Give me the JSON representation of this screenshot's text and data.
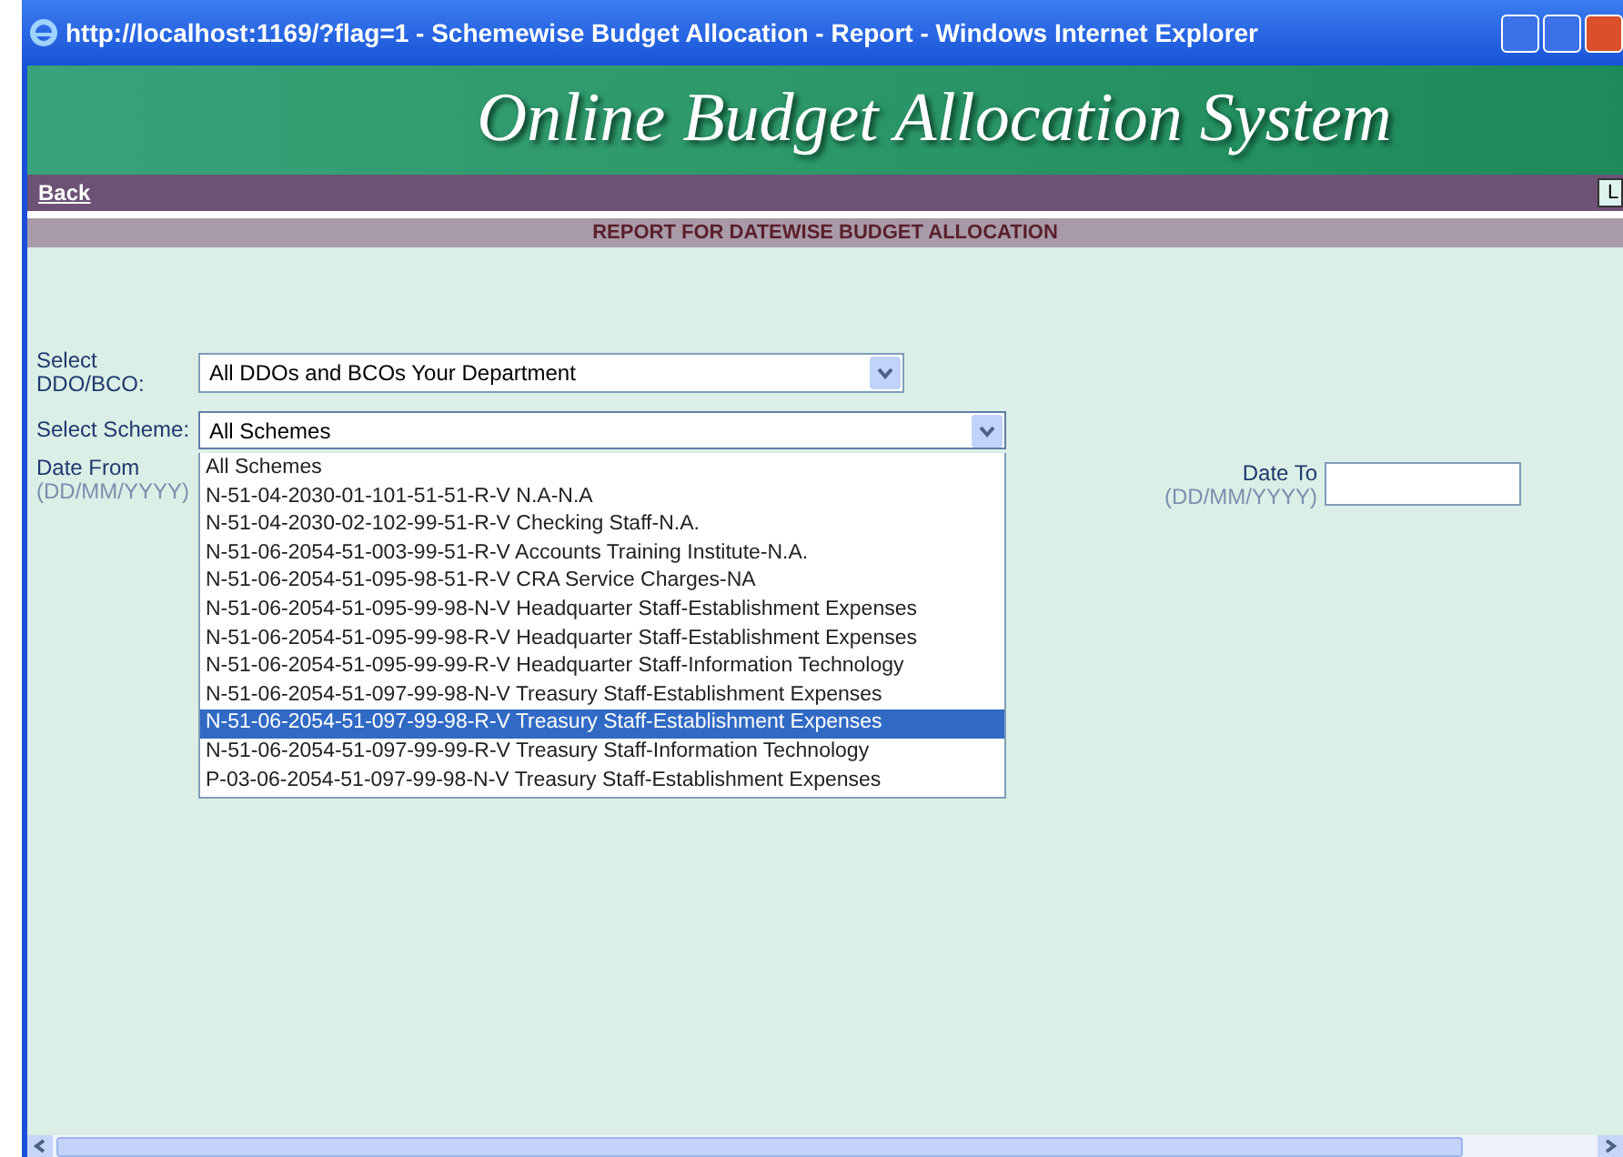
{
  "window": {
    "title": "http://localhost:1169/?flag=1 - Schemewise Budget Allocation - Report - Windows Internet Explorer"
  },
  "banner": {
    "title": "Online Budget Allocation System"
  },
  "nav": {
    "links": [
      {
        "label": "Back"
      }
    ],
    "edge_button": "L"
  },
  "heading": "REPORT FOR DATEWISE BUDGET ALLOCATION",
  "form": {
    "ddo": {
      "label": "Select DDO/BCO:",
      "value": "All DDOs and BCOs Your Department"
    },
    "scheme": {
      "label": "Select Scheme:",
      "value": "All Schemes",
      "expanded": true,
      "options": [
        {
          "label": "All Schemes",
          "highlighted": false
        },
        {
          "label": "N-51-04-2030-01-101-51-51-R-V N.A-N.A",
          "highlighted": false
        },
        {
          "label": "N-51-04-2030-02-102-99-51-R-V Checking Staff-N.A.",
          "highlighted": false
        },
        {
          "label": "N-51-06-2054-51-003-99-51-R-V Accounts Training Institute-N.A.",
          "highlighted": false
        },
        {
          "label": "N-51-06-2054-51-095-98-51-R-V CRA Service Charges-NA",
          "highlighted": false
        },
        {
          "label": "N-51-06-2054-51-095-99-98-N-V Headquarter Staff-Establishment Expenses",
          "highlighted": false
        },
        {
          "label": "N-51-06-2054-51-095-99-98-R-V Headquarter Staff-Establishment Expenses",
          "highlighted": false
        },
        {
          "label": "N-51-06-2054-51-095-99-99-R-V Headquarter Staff-Information Technology",
          "highlighted": false
        },
        {
          "label": "N-51-06-2054-51-097-99-98-N-V Treasury Staff-Establishment Expenses",
          "highlighted": false
        },
        {
          "label": "N-51-06-2054-51-097-99-98-R-V Treasury Staff-Establishment Expenses",
          "highlighted": true
        },
        {
          "label": "N-51-06-2054-51-097-99-99-R-V Treasury Staff-Information Technology",
          "highlighted": false
        },
        {
          "label": "P-03-06-2054-51-097-99-98-N-V Treasury Staff-Establishment Expenses",
          "highlighted": false
        }
      ]
    },
    "date_from": {
      "label": "Date From",
      "format": "(DD/MM/YYYY)"
    },
    "date_to": {
      "label": "Date To",
      "format": "(DD/MM/YYYY)"
    }
  }
}
